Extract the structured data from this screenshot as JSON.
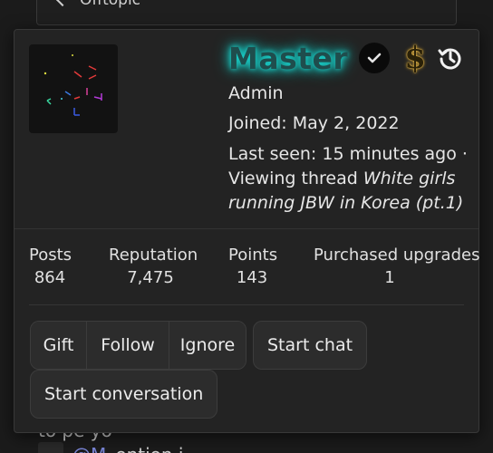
{
  "background": {
    "breadcrumb": "Offtopic",
    "post_fragment": "to pe      yo",
    "mention": "@M",
    "post_rest": "ention i"
  },
  "profile": {
    "username": "Master",
    "role": "Admin",
    "joined": "Joined: May 2, 2022",
    "last_seen": "Last seen: 15 minutes ago ·",
    "viewing_prefix": "Viewing thread ",
    "viewing_thread": "White girls running JBW in Korea (pt.1)",
    "colors": {
      "username_glow": "#19d6cf",
      "dollar": "#e7b84a"
    },
    "icons": [
      "verified-icon",
      "dollar-icon",
      "history-icon"
    ]
  },
  "stats": [
    {
      "label": "Posts",
      "value": "864"
    },
    {
      "label": "Reputation",
      "value": "7,475"
    },
    {
      "label": "Points",
      "value": "143"
    },
    {
      "label": "Purchased upgrades",
      "value": "1"
    }
  ],
  "actions": {
    "gift": "Gift",
    "follow": "Follow",
    "ignore": "Ignore",
    "start_chat": "Start chat",
    "start_conversation": "Start conversation"
  }
}
